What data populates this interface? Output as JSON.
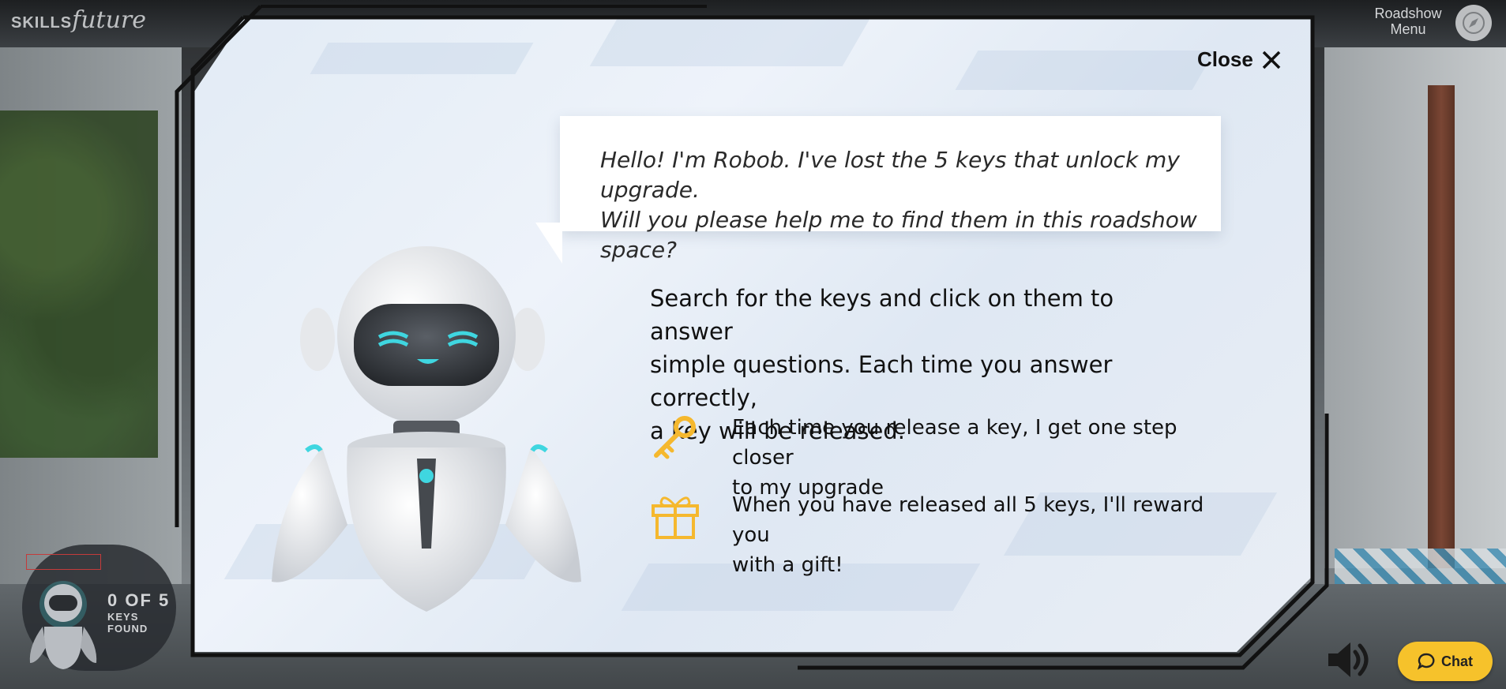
{
  "topbar": {
    "logo_skills": "SKILLS",
    "logo_future": "future",
    "menu_line1": "Roadshow",
    "menu_line2": "Menu"
  },
  "modal": {
    "close_label": "Close",
    "speech_line1": "Hello! I'm Robob. I've lost the 5 keys that unlock my upgrade.",
    "speech_line2": "Will you please help me to find them in this roadshow space?",
    "intro_line1": "Search for the keys and click on them to answer",
    "intro_line2": "simple questions. Each time you answer correctly,",
    "intro_line3": "a key will be released.",
    "items": [
      {
        "icon": "key-icon",
        "line1": "Each time you release a key, I get one step closer",
        "line2": "to my upgrade"
      },
      {
        "icon": "gift-icon",
        "line1": "When you have released all 5 keys, I'll reward you",
        "line2": "with a gift!"
      }
    ]
  },
  "keys_badge": {
    "count": "0 OF 5",
    "label": "KEYS FOUND"
  },
  "chat": {
    "label": "Chat"
  },
  "colors": {
    "accent_yellow": "#F6C22B",
    "icon_yellow": "#F5B82E",
    "robot_glow": "#3FD6E0",
    "frame_black": "#111111"
  }
}
